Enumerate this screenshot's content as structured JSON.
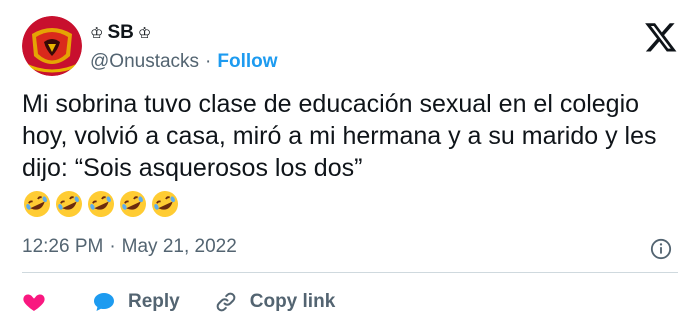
{
  "header": {
    "display_name": "SB",
    "name_prefix_symbol": "♔",
    "name_suffix_symbol": "♔",
    "handle": "@Onustacks",
    "separator": "·",
    "follow_label": "Follow"
  },
  "tweet": {
    "text": "Mi sobrina tuvo clase de educación sexual en el colegio hoy, volvió a casa, miró a mi hermana y a su marido y les dijo: “Sois asquerosos los dos”",
    "emoji_icons": [
      "rolling-on-floor-laughing-icon",
      "rolling-on-floor-laughing-icon",
      "rolling-on-floor-laughing-icon",
      "rolling-on-floor-laughing-icon",
      "rolling-on-floor-laughing-icon"
    ]
  },
  "meta": {
    "time": "12:26 PM",
    "separator": "·",
    "date": "May 21, 2022"
  },
  "actions": {
    "reply_label": "Reply",
    "copy_link_label": "Copy link"
  },
  "colors": {
    "text": "#0f1419",
    "secondary": "#536471",
    "link": "#1d9bf0",
    "like": "#f91880",
    "reply": "#1d9bf0",
    "divider": "#cfd9de"
  },
  "icons": {
    "avatar": "manchester-united-crest-avatar",
    "brand": "x-logo-icon",
    "info": "info-icon",
    "like": "heart-icon",
    "reply": "speech-bubble-icon",
    "copy": "link-icon"
  }
}
